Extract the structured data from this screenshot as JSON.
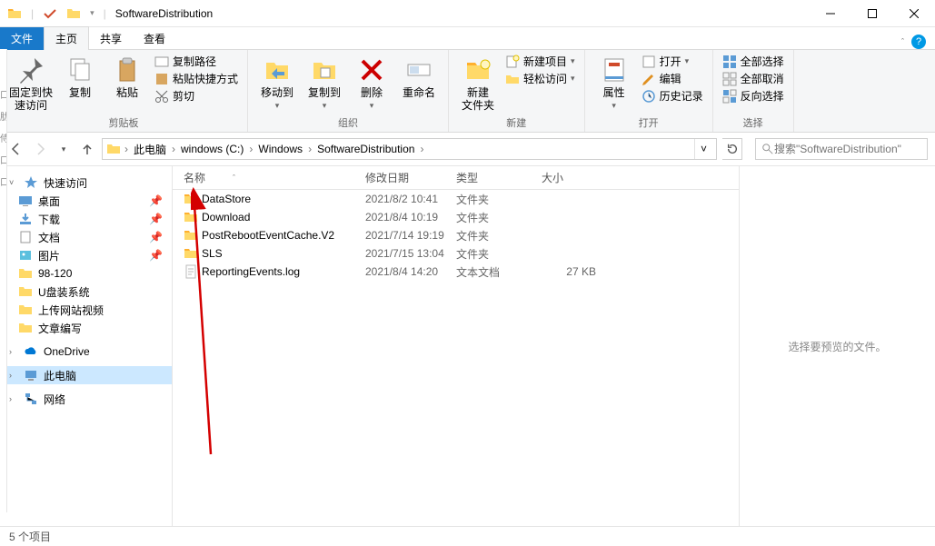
{
  "window": {
    "title": "SoftwareDistribution"
  },
  "tabs": {
    "file": "文件",
    "home": "主页",
    "share": "共享",
    "view": "查看"
  },
  "ribbon": {
    "group1": {
      "pin": "固定到快\n速访问",
      "copy": "复制",
      "paste": "粘贴",
      "copypath": "复制路径",
      "pasteshort": "粘贴快捷方式",
      "cut": "剪切",
      "label": "剪贴板"
    },
    "group2": {
      "moveto": "移动到",
      "copyto": "复制到",
      "delete": "删除",
      "rename": "重命名",
      "label": "组织"
    },
    "group3": {
      "newfolder": "新建\n文件夹",
      "newitem": "新建项目",
      "easyaccess": "轻松访问",
      "label": "新建"
    },
    "group4": {
      "props": "属性",
      "open": "打开",
      "edit": "编辑",
      "history": "历史记录",
      "label": "打开"
    },
    "group5": {
      "selectall": "全部选择",
      "selectnone": "全部取消",
      "invert": "反向选择",
      "label": "选择"
    }
  },
  "breadcrumb": {
    "b0": "此电脑",
    "b1": "windows (C:)",
    "b2": "Windows",
    "b3": "SoftwareDistribution"
  },
  "search": {
    "placeholder": "搜索\"SoftwareDistribution\""
  },
  "sidebar": {
    "quick": "快速访问",
    "items": [
      {
        "label": "桌面"
      },
      {
        "label": "下载"
      },
      {
        "label": "文档"
      },
      {
        "label": "图片"
      },
      {
        "label": "98-120"
      },
      {
        "label": "U盘装系统"
      },
      {
        "label": "上传网站视频"
      },
      {
        "label": "文章编写"
      }
    ],
    "onedrive": "OneDrive",
    "thispc": "此电脑",
    "network": "网络"
  },
  "columns": {
    "name": "名称",
    "date": "修改日期",
    "type": "类型",
    "size": "大小"
  },
  "files": [
    {
      "name": "DataStore",
      "date": "2021/8/2 10:41",
      "type": "文件夹",
      "size": "",
      "kind": "folder"
    },
    {
      "name": "Download",
      "date": "2021/8/4 10:19",
      "type": "文件夹",
      "size": "",
      "kind": "folder"
    },
    {
      "name": "PostRebootEventCache.V2",
      "date": "2021/7/14 19:19",
      "type": "文件夹",
      "size": "",
      "kind": "folder"
    },
    {
      "name": "SLS",
      "date": "2021/7/15 13:04",
      "type": "文件夹",
      "size": "",
      "kind": "folder"
    },
    {
      "name": "ReportingEvents.log",
      "date": "2021/8/4 14:20",
      "type": "文本文档",
      "size": "27 KB",
      "kind": "txt"
    }
  ],
  "preview": {
    "msg": "选择要预览的文件。"
  },
  "status": {
    "msg": "5 个项目"
  }
}
